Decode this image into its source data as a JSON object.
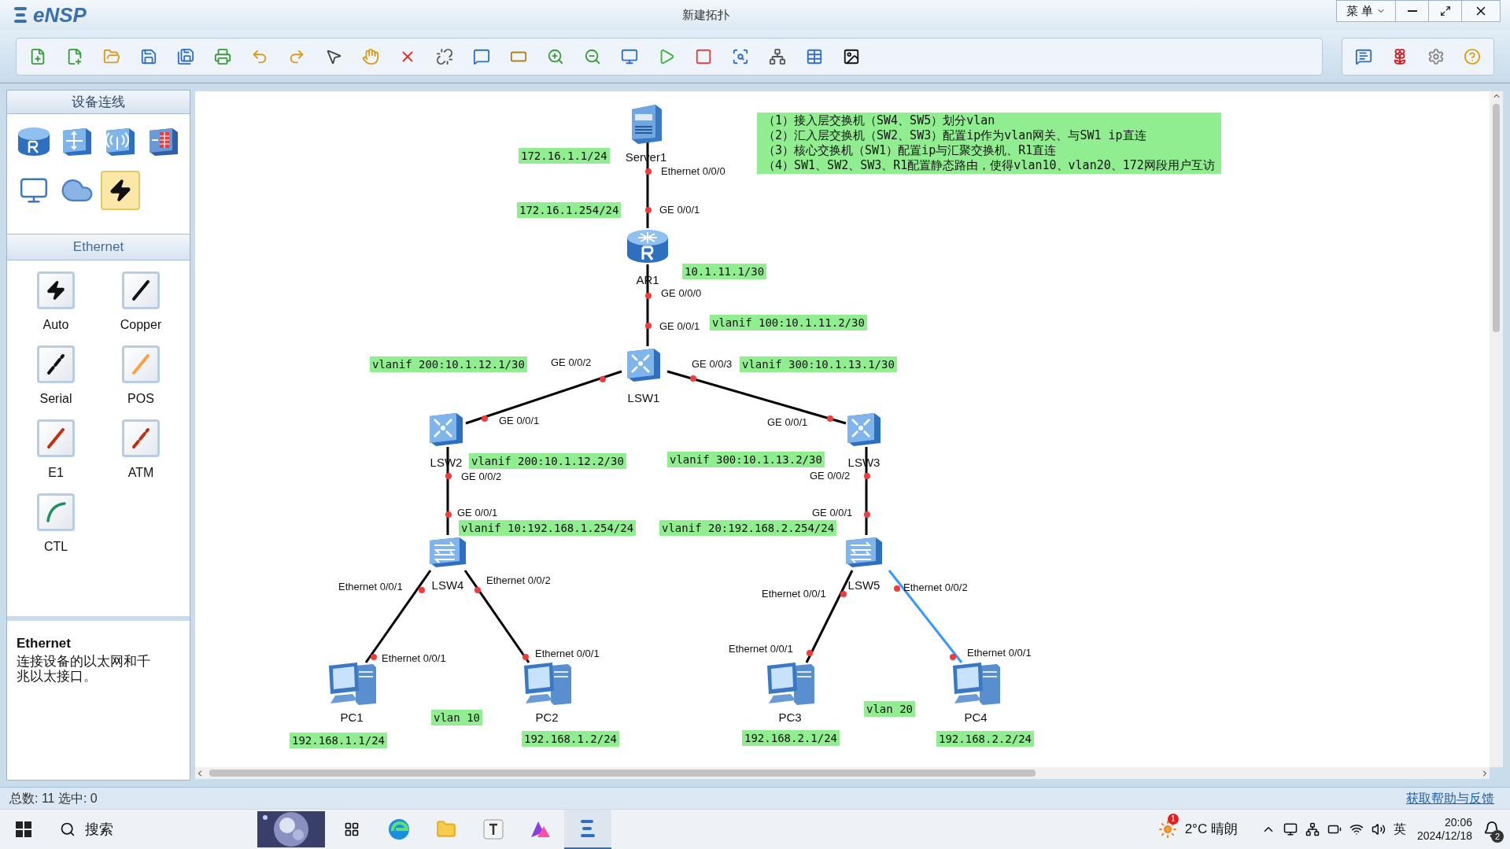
{
  "window": {
    "logo": "eNSP",
    "title": "新建拓扑",
    "menu_button": "菜 单"
  },
  "device_panel": {
    "title": "设备连线",
    "devices": [
      {
        "kind": "router",
        "selected": false
      },
      {
        "kind": "switch",
        "selected": false
      },
      {
        "kind": "wireless",
        "selected": false
      },
      {
        "kind": "firewall",
        "selected": false
      },
      {
        "kind": "terminal",
        "selected": false
      },
      {
        "kind": "cloud",
        "selected": false
      },
      {
        "kind": "cable",
        "selected": true
      }
    ],
    "category_title": "Ethernet",
    "cables": [
      {
        "label": "Auto",
        "selected": false
      },
      {
        "label": "Copper",
        "selected": false
      },
      {
        "label": "Serial",
        "selected": false
      },
      {
        "label": "POS",
        "selected": false
      },
      {
        "label": "E1",
        "selected": false
      },
      {
        "label": "ATM",
        "selected": false
      },
      {
        "label": "CTL",
        "selected": false
      }
    ],
    "description": {
      "title": "Ethernet",
      "text": "连接设备的以太网和千兆以太接口。"
    }
  },
  "topology": {
    "nodes": [
      {
        "kind": "server",
        "label": "Server1"
      },
      {
        "kind": "router",
        "label": "AR1"
      },
      {
        "kind": "l3switch",
        "label": "LSW1"
      },
      {
        "kind": "l3switch",
        "label": "LSW2"
      },
      {
        "kind": "l3switch",
        "label": "LSW3"
      },
      {
        "kind": "l2switch",
        "label": "LSW4"
      },
      {
        "kind": "l2switch",
        "label": "LSW5"
      },
      {
        "kind": "pc",
        "label": "PC1"
      },
      {
        "kind": "pc",
        "label": "PC2"
      },
      {
        "kind": "pc",
        "label": "PC3"
      },
      {
        "kind": "pc",
        "label": "PC4"
      }
    ],
    "links": [
      {
        "color": "#000000"
      },
      {
        "color": "#000000"
      },
      {
        "color": "#000000"
      },
      {
        "color": "#000000"
      },
      {
        "color": "#000000"
      },
      {
        "color": "#000000"
      },
      {
        "color": "#000000"
      },
      {
        "color": "#000000"
      },
      {
        "color": "#000000"
      },
      {
        "color": "#3399ff"
      }
    ],
    "interface_labels": [
      "Ethernet 0/0/0",
      "GE 0/0/1",
      "GE 0/0/0",
      "GE 0/0/1",
      "GE 0/0/2",
      "GE 0/0/3",
      "GE 0/0/1",
      "GE 0/0/1",
      "GE 0/0/2",
      "GE 0/0/2",
      "GE 0/0/1",
      "GE 0/0/1",
      "Ethernet 0/0/1",
      "Ethernet 0/0/2",
      "Ethernet 0/0/1",
      "Ethernet 0/0/2",
      "Ethernet 0/0/1",
      "Ethernet 0/0/1",
      "Ethernet 0/0/1",
      "Ethernet 0/0/1"
    ],
    "address_labels": [
      "172.16.1.1/24",
      "172.16.1.254/24",
      "10.1.11.1/30",
      "vlanif 100:10.1.11.2/30",
      "vlanif 200:10.1.12.1/30",
      "vlanif 300:10.1.13.1/30",
      "vlanif 200:10.1.12.2/30",
      "vlanif 300:10.1.13.2/30",
      "vlanif 10:192.168.1.254/24",
      "vlanif 20:192.168.2.254/24",
      "vlan 10",
      "vlan 20",
      "192.168.1.1/24",
      "192.168.1.2/24",
      "192.168.2.1/24",
      "192.168.2.2/24"
    ],
    "note": [
      "（1）接入层交换机（SW4、SW5）划分vlan",
      "（2）汇入层交换机（SW2、SW3）配置ip作为vlan网关、与SW1 ip直连",
      "（3）核心交换机（SW1）配置ip与汇聚交换机、R1直连",
      "（4）SW1、SW2、SW3、R1配置静态路由，使得vlan10、vlan20、172网段用户互访"
    ]
  },
  "status_bar": {
    "counts": "总数: 11 选中: 0",
    "help_link": "获取帮助与反馈"
  },
  "taskbar": {
    "search": "搜索",
    "weather_badge": "1",
    "weather": "2°C 晴朗",
    "language": "英",
    "time": "20:06",
    "date": "2024/12/18",
    "notification_count": "2"
  }
}
